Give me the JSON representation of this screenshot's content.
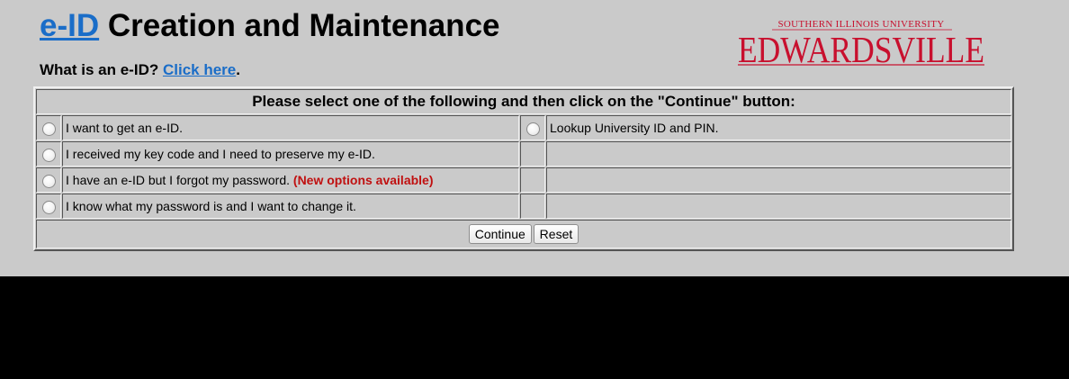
{
  "header": {
    "title_link": "e-ID",
    "title_rest": "Creation and Maintenance",
    "whatis_text": "What is an e-ID?",
    "whatis_link": "Click here",
    "whatis_end": "."
  },
  "logo": {
    "top": "SOUTHERN ILLINOIS UNIVERSITY",
    "main": "EDWARDSVILLE",
    "color": "#c8102e"
  },
  "form": {
    "header": "Please select one of the following and then click on the \"Continue\" button:",
    "options": [
      {
        "label": "I want to get an e-ID.",
        "extra": ""
      },
      {
        "label": "I received my key code and I need to preserve my e-ID.",
        "extra": ""
      },
      {
        "label": "I have an e-ID but I forgot my password.",
        "extra": "(New options available)"
      },
      {
        "label": "I know what my password is and I want to change it.",
        "extra": ""
      }
    ],
    "right_options": [
      {
        "label": "Lookup University ID and PIN."
      }
    ],
    "continue_label": "Continue",
    "reset_label": "Reset"
  },
  "colors": {
    "page_bg": "#cacaca",
    "link": "#1a6dc8",
    "highlight": "#c01010"
  }
}
